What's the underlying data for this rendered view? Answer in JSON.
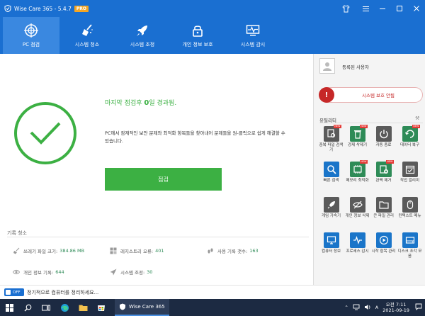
{
  "window": {
    "title": "Wise Care 365 - 5.4.7",
    "badge": "PRO"
  },
  "nav": {
    "items": [
      {
        "label": "PC 점검",
        "icon": "globe-target-icon"
      },
      {
        "label": "시스템 청소",
        "icon": "broom-icon"
      },
      {
        "label": "시스템 조정",
        "icon": "rocket-icon"
      },
      {
        "label": "개인 정보 보호",
        "icon": "lock-icon"
      },
      {
        "label": "시스템 감시",
        "icon": "monitor-pulse-icon"
      }
    ]
  },
  "main": {
    "last_check_prefix": "마지막 점검후 ",
    "last_check_days": "0",
    "last_check_suffix": "일 경과됨.",
    "description": "PC에서 잠재적인 보안 문제와 최적화 항목들을 찾아내어 문제들을 원-클릭으로 쉽게 해결할 수 있습니다.",
    "scan_button": "점검"
  },
  "records": {
    "title": "기록 청소",
    "items": [
      {
        "label": "쓰레기 파일 크기:",
        "value": "384.86 MB"
      },
      {
        "label": "레지스트리 오류:",
        "value": "401"
      },
      {
        "label": "사용 기록 갯수:",
        "value": "163"
      },
      {
        "label": "개인 정보 기록:",
        "value": "644"
      },
      {
        "label": "시스템 조정:",
        "value": "30"
      }
    ]
  },
  "bottom": {
    "toggle_label": "OFF",
    "text": "정기적으로 컴퓨터를 정리하세요..."
  },
  "right": {
    "username": "등록된 사용자",
    "protection": "시스템 보호 안됨",
    "utilities_label": "유틸리티",
    "tiles": [
      {
        "label": "중복 파일 검색기",
        "color": "#5a5a5a",
        "new": true
      },
      {
        "label": "강제 삭제기",
        "color": "#2e8b57",
        "new": true
      },
      {
        "label": "자동 종료",
        "color": "#5a5a5a",
        "new": false
      },
      {
        "label": "데이터 복구",
        "color": "#2e8b57",
        "new": true
      },
      {
        "label": "빠른 검색",
        "color": "#1a75c9",
        "new": false
      },
      {
        "label": "메모리 최적화",
        "color": "#2e8b57",
        "new": true
      },
      {
        "label": "완벽 제거",
        "color": "#2e8b57",
        "new": true
      },
      {
        "label": "작업 알리미",
        "color": "#5a5a5a",
        "new": false
      },
      {
        "label": "게임 가속기",
        "color": "#5a5a5a",
        "new": false
      },
      {
        "label": "개인 정보 삭제",
        "color": "#5a5a5a",
        "new": false
      },
      {
        "label": "큰 파일 관리",
        "color": "#5a5a5a",
        "new": false
      },
      {
        "label": "컨텍스트 메뉴",
        "color": "#5a5a5a",
        "new": false
      },
      {
        "label": "컴퓨터 정보",
        "color": "#1a75c9",
        "new": false
      },
      {
        "label": "프로세스 감시",
        "color": "#1a75c9",
        "new": false
      },
      {
        "label": "시작 항목 관리",
        "color": "#1a75c9",
        "new": false
      },
      {
        "label": "디스크 조각 모음",
        "color": "#1a75c9",
        "new": false
      }
    ]
  },
  "taskbar": {
    "app_label": "Wise Care 365",
    "time": "오전 7:11",
    "date": "2021-09-19",
    "lang": "A"
  }
}
